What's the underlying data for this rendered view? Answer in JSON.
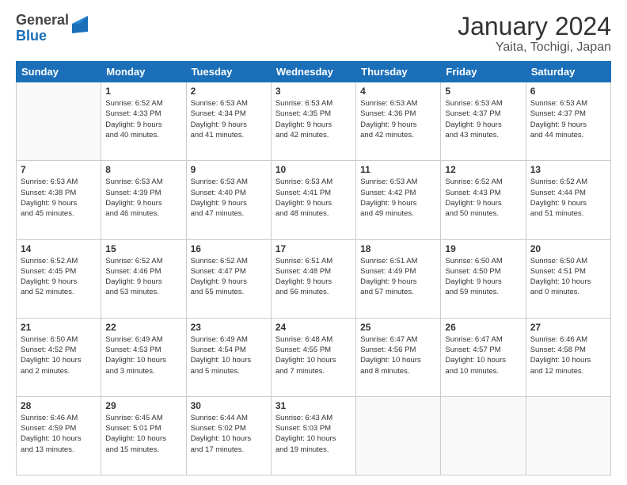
{
  "logo": {
    "part1": "General",
    "part2": "Blue"
  },
  "title": "January 2024",
  "subtitle": "Yaita, Tochigi, Japan",
  "days_header": [
    "Sunday",
    "Monday",
    "Tuesday",
    "Wednesday",
    "Thursday",
    "Friday",
    "Saturday"
  ],
  "weeks": [
    [
      {
        "day": "",
        "info": ""
      },
      {
        "day": "1",
        "info": "Sunrise: 6:52 AM\nSunset: 4:33 PM\nDaylight: 9 hours\nand 40 minutes."
      },
      {
        "day": "2",
        "info": "Sunrise: 6:53 AM\nSunset: 4:34 PM\nDaylight: 9 hours\nand 41 minutes."
      },
      {
        "day": "3",
        "info": "Sunrise: 6:53 AM\nSunset: 4:35 PM\nDaylight: 9 hours\nand 42 minutes."
      },
      {
        "day": "4",
        "info": "Sunrise: 6:53 AM\nSunset: 4:36 PM\nDaylight: 9 hours\nand 42 minutes."
      },
      {
        "day": "5",
        "info": "Sunrise: 6:53 AM\nSunset: 4:37 PM\nDaylight: 9 hours\nand 43 minutes."
      },
      {
        "day": "6",
        "info": "Sunrise: 6:53 AM\nSunset: 4:37 PM\nDaylight: 9 hours\nand 44 minutes."
      }
    ],
    [
      {
        "day": "7",
        "info": "Sunrise: 6:53 AM\nSunset: 4:38 PM\nDaylight: 9 hours\nand 45 minutes."
      },
      {
        "day": "8",
        "info": "Sunrise: 6:53 AM\nSunset: 4:39 PM\nDaylight: 9 hours\nand 46 minutes."
      },
      {
        "day": "9",
        "info": "Sunrise: 6:53 AM\nSunset: 4:40 PM\nDaylight: 9 hours\nand 47 minutes."
      },
      {
        "day": "10",
        "info": "Sunrise: 6:53 AM\nSunset: 4:41 PM\nDaylight: 9 hours\nand 48 minutes."
      },
      {
        "day": "11",
        "info": "Sunrise: 6:53 AM\nSunset: 4:42 PM\nDaylight: 9 hours\nand 49 minutes."
      },
      {
        "day": "12",
        "info": "Sunrise: 6:52 AM\nSunset: 4:43 PM\nDaylight: 9 hours\nand 50 minutes."
      },
      {
        "day": "13",
        "info": "Sunrise: 6:52 AM\nSunset: 4:44 PM\nDaylight: 9 hours\nand 51 minutes."
      }
    ],
    [
      {
        "day": "14",
        "info": "Sunrise: 6:52 AM\nSunset: 4:45 PM\nDaylight: 9 hours\nand 52 minutes."
      },
      {
        "day": "15",
        "info": "Sunrise: 6:52 AM\nSunset: 4:46 PM\nDaylight: 9 hours\nand 53 minutes."
      },
      {
        "day": "16",
        "info": "Sunrise: 6:52 AM\nSunset: 4:47 PM\nDaylight: 9 hours\nand 55 minutes."
      },
      {
        "day": "17",
        "info": "Sunrise: 6:51 AM\nSunset: 4:48 PM\nDaylight: 9 hours\nand 56 minutes."
      },
      {
        "day": "18",
        "info": "Sunrise: 6:51 AM\nSunset: 4:49 PM\nDaylight: 9 hours\nand 57 minutes."
      },
      {
        "day": "19",
        "info": "Sunrise: 6:50 AM\nSunset: 4:50 PM\nDaylight: 9 hours\nand 59 minutes."
      },
      {
        "day": "20",
        "info": "Sunrise: 6:50 AM\nSunset: 4:51 PM\nDaylight: 10 hours\nand 0 minutes."
      }
    ],
    [
      {
        "day": "21",
        "info": "Sunrise: 6:50 AM\nSunset: 4:52 PM\nDaylight: 10 hours\nand 2 minutes."
      },
      {
        "day": "22",
        "info": "Sunrise: 6:49 AM\nSunset: 4:53 PM\nDaylight: 10 hours\nand 3 minutes."
      },
      {
        "day": "23",
        "info": "Sunrise: 6:49 AM\nSunset: 4:54 PM\nDaylight: 10 hours\nand 5 minutes."
      },
      {
        "day": "24",
        "info": "Sunrise: 6:48 AM\nSunset: 4:55 PM\nDaylight: 10 hours\nand 7 minutes."
      },
      {
        "day": "25",
        "info": "Sunrise: 6:47 AM\nSunset: 4:56 PM\nDaylight: 10 hours\nand 8 minutes."
      },
      {
        "day": "26",
        "info": "Sunrise: 6:47 AM\nSunset: 4:57 PM\nDaylight: 10 hours\nand 10 minutes."
      },
      {
        "day": "27",
        "info": "Sunrise: 6:46 AM\nSunset: 4:58 PM\nDaylight: 10 hours\nand 12 minutes."
      }
    ],
    [
      {
        "day": "28",
        "info": "Sunrise: 6:46 AM\nSunset: 4:59 PM\nDaylight: 10 hours\nand 13 minutes."
      },
      {
        "day": "29",
        "info": "Sunrise: 6:45 AM\nSunset: 5:01 PM\nDaylight: 10 hours\nand 15 minutes."
      },
      {
        "day": "30",
        "info": "Sunrise: 6:44 AM\nSunset: 5:02 PM\nDaylight: 10 hours\nand 17 minutes."
      },
      {
        "day": "31",
        "info": "Sunrise: 6:43 AM\nSunset: 5:03 PM\nDaylight: 10 hours\nand 19 minutes."
      },
      {
        "day": "",
        "info": ""
      },
      {
        "day": "",
        "info": ""
      },
      {
        "day": "",
        "info": ""
      }
    ]
  ]
}
